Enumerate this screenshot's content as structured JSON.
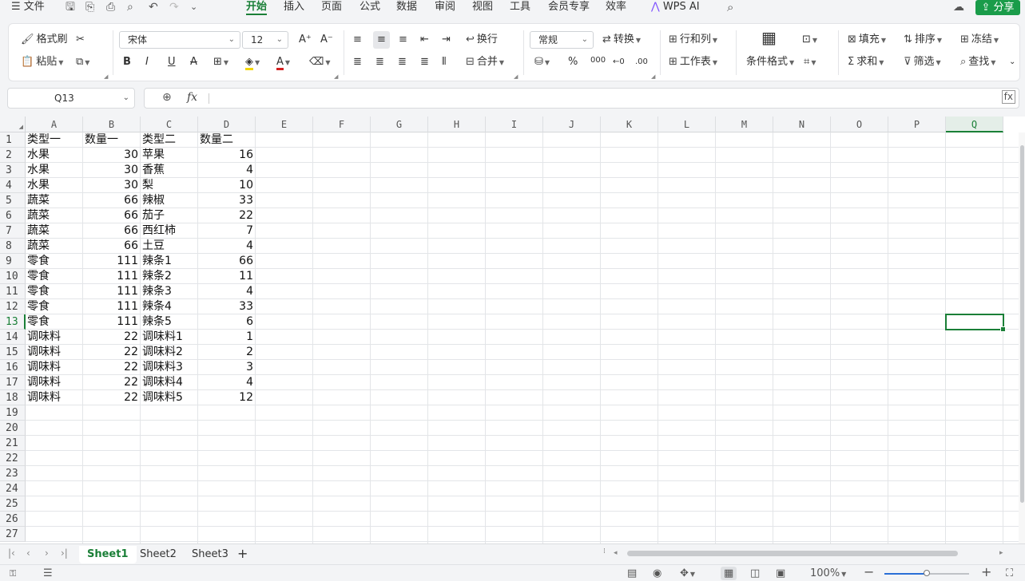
{
  "menubar": {
    "file": "文件",
    "tabs": [
      "开始",
      "插入",
      "页面",
      "公式",
      "数据",
      "审阅",
      "视图",
      "工具",
      "会员专享",
      "效率"
    ],
    "active_tab": "开始",
    "ai": "WPS AI",
    "share": "分享"
  },
  "ribbon": {
    "format_painter": "格式刷",
    "paste": "粘贴",
    "font_name": "宋体",
    "font_size": "12",
    "wrap": "换行",
    "merge": "合并",
    "number_format": "常规",
    "convert": "转换",
    "rows_cols": "行和列",
    "worksheet": "工作表",
    "cond_format": "条件格式",
    "fill": "填充",
    "sort": "排序",
    "freeze": "冻结",
    "sum": "求和",
    "filter": "筛选",
    "find": "查找",
    "font_color": "#d42020",
    "fill_color": "#f2d600"
  },
  "namebox": "Q13",
  "formula": "",
  "columns": [
    "A",
    "B",
    "C",
    "D",
    "E",
    "F",
    "G",
    "H",
    "I",
    "J",
    "K",
    "L",
    "M",
    "N",
    "O",
    "P",
    "Q"
  ],
  "selected_col": "Q",
  "selected_row": 13,
  "rows": [
    [
      "类型一",
      "数量一",
      "类型二",
      "数量二"
    ],
    [
      "水果",
      "30",
      "苹果",
      "16"
    ],
    [
      "水果",
      "30",
      "香蕉",
      "4"
    ],
    [
      "水果",
      "30",
      "梨",
      "10"
    ],
    [
      "蔬菜",
      "66",
      "辣椒",
      "33"
    ],
    [
      "蔬菜",
      "66",
      "茄子",
      "22"
    ],
    [
      "蔬菜",
      "66",
      "西红柿",
      "7"
    ],
    [
      "蔬菜",
      "66",
      "土豆",
      "4"
    ],
    [
      "零食",
      "111",
      "辣条1",
      "66"
    ],
    [
      "零食",
      "111",
      "辣条2",
      "11"
    ],
    [
      "零食",
      "111",
      "辣条3",
      "4"
    ],
    [
      "零食",
      "111",
      "辣条4",
      "33"
    ],
    [
      "零食",
      "111",
      "辣条5",
      "6"
    ],
    [
      "调味料",
      "22",
      "调味料1",
      "1"
    ],
    [
      "调味料",
      "22",
      "调味料2",
      "2"
    ],
    [
      "调味料",
      "22",
      "调味料3",
      "3"
    ],
    [
      "调味料",
      "22",
      "调味料4",
      "4"
    ],
    [
      "调味料",
      "22",
      "调味料5",
      "12"
    ]
  ],
  "visible_row_count": 27,
  "sheets": [
    "Sheet1",
    "Sheet2",
    "Sheet3"
  ],
  "active_sheet": "Sheet1",
  "status": {
    "zoom": "100%",
    "zoom_level": 0.5
  },
  "accent": "#1a7f37"
}
